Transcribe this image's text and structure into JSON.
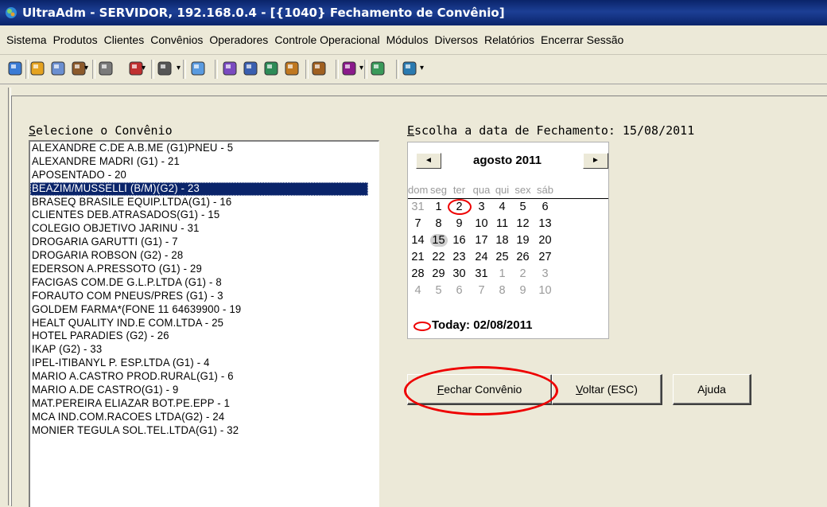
{
  "window": {
    "title": "UltraAdm - SERVIDOR, 192.168.0.4 - [{1040} Fechamento de Convênio]"
  },
  "menu": [
    "Sistema",
    "Produtos",
    "Clientes",
    "Convênios",
    "Operadores",
    "Controle Operacional",
    "Módulos",
    "Diversos",
    "Relatórios",
    "Encerrar Sessão"
  ],
  "toolbar_icons": [
    "home-icon",
    "globe-icon",
    "calendar-icon",
    "users-icon",
    "coins-icon",
    "report-edit-icon",
    "hand-pointer-icon",
    "printer-icon",
    "accounting-icon",
    "search-icon",
    "clock-icon",
    "chart-icon",
    "people-icon",
    "line-chart-icon",
    "tools-icon",
    "exit-icon"
  ],
  "convenio": {
    "label_prefix": "S",
    "label_rest": "elecione o Convênio",
    "items": [
      "ALEXANDRE C.DE A.B.ME (G1)PNEU - 5",
      "ALEXANDRE MADRI (G1) - 21",
      "APOSENTADO - 20",
      "BEAZIM/MUSSELLI (B/M)(G2) - 23",
      "BRASEQ BRASILE EQUIP.LTDA(G1) - 16",
      "CLIENTES DEB.ATRASADOS(G1) - 15",
      "COLEGIO OBJETIVO JARINU - 31",
      "DROGARIA GARUTTI (G1) - 7",
      "DROGARIA ROBSON (G2) - 28",
      "EDERSON A.PRESSOTO (G1) - 29",
      "FACIGAS COM.DE G.L.P.LTDA (G1) - 8",
      "FORAUTO COM PNEUS/PRES (G1) - 3",
      "GOLDEM FARMA*(FONE 11 64639900 - 19",
      "HEALT QUALITY IND.E COM.LTDA - 25",
      "HOTEL PARADIES (G2) - 26",
      "IKAP (G2) - 33",
      "IPEL-ITIBANYL P. ESP.LTDA (G1) - 4",
      "MARIO  A.CASTRO PROD.RURAL(G1) - 6",
      "MARIO A.DE CASTRO(G1) - 9",
      "MAT.PEREIRA ELIAZAR BOT.PE.EPP - 1",
      "MCA IND.COM.RACOES LTDA(G2) - 24",
      "MONIER TEGULA SOL.TEL.LTDA(G1) - 32"
    ],
    "selected_index": 3
  },
  "date": {
    "label_prefix": "E",
    "label_rest": "scolha a data de Fechamento: 15/08/2011",
    "month_title": "agosto 2011",
    "prev": "◄",
    "next": "►",
    "weekdays": [
      "dom",
      "seg",
      "ter",
      "qua",
      "qui",
      "sex",
      "sáb"
    ],
    "days": [
      [
        "31",
        "1",
        "2",
        "3",
        "4",
        "5",
        "6"
      ],
      [
        "7",
        "8",
        "9",
        "10",
        "11",
        "12",
        "13"
      ],
      [
        "14",
        "15",
        "16",
        "17",
        "18",
        "19",
        "20"
      ],
      [
        "21",
        "22",
        "23",
        "24",
        "25",
        "26",
        "27"
      ],
      [
        "28",
        "29",
        "30",
        "31",
        "1",
        "2",
        "3"
      ],
      [
        "4",
        "5",
        "6",
        "7",
        "8",
        "9",
        "10"
      ]
    ],
    "selected_day": "15",
    "today_day": "2",
    "today_label": "Today: 02/08/2011"
  },
  "buttons": {
    "close": {
      "mnemonic": "F",
      "rest": "echar Convênio"
    },
    "back": {
      "mnemonic": "V",
      "rest": "oltar (ESC)"
    },
    "help": {
      "mnemonic": "",
      "rest": "Ajuda"
    }
  },
  "colors": {
    "title": "#0a246a",
    "selection": "#0a246a",
    "annotation": "#e00000"
  }
}
